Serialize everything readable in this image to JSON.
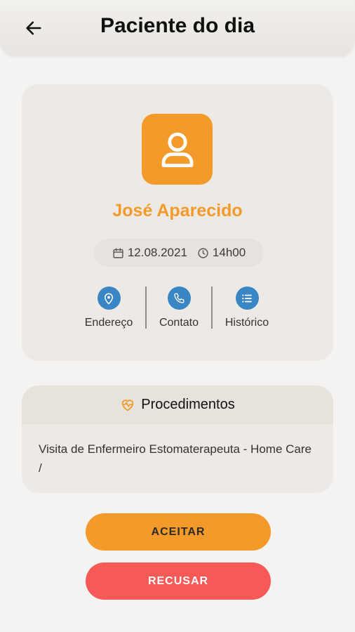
{
  "header": {
    "title": "Paciente do dia",
    "back_icon": "arrow-left-icon"
  },
  "patient": {
    "name": "José Aparecido",
    "avatar_icon": "user-icon",
    "date": "12.08.2021",
    "time": "14h00"
  },
  "actions": [
    {
      "label": "Endereço",
      "icon": "map-pin-icon"
    },
    {
      "label": "Contato",
      "icon": "phone-icon"
    },
    {
      "label": "Histórico",
      "icon": "list-icon"
    }
  ],
  "procedures": {
    "title": "Procedimentos",
    "icon": "heart-pulse-icon",
    "text": "Visita de Enfermeiro Estomaterapeuta - Home Care /"
  },
  "buttons": {
    "accept": "ACEITAR",
    "reject": "RECUSAR"
  },
  "colors": {
    "accent": "#f39a2b",
    "danger": "#f55a57",
    "icon_blue": "#3a86c4"
  }
}
